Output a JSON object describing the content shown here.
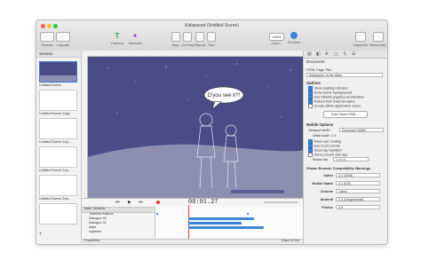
{
  "window": {
    "title": "Kidspaced (Untitled Scene)",
    "toolbar": {
      "left": [
        "Scenes",
        "Layouts"
      ],
      "center": [
        "Camera",
        "Symbols"
      ],
      "stage_tools": [
        "Stop",
        "Overlay",
        "Objects",
        "Text"
      ],
      "zoom_value": "100%",
      "right": [
        "Zoom",
        "Preview"
      ],
      "far_right": [
        "Inspector",
        "Resources"
      ]
    }
  },
  "sidebar": {
    "header": "Scenes",
    "scenes": [
      "Untitled Scene",
      "Untitled Scene Copy",
      "Untitled Scene Cop...",
      "Untitled Scene Cop...",
      "Untitled Scene Cop..."
    ]
  },
  "stage": {
    "speech_bubble": "D'you see it?!"
  },
  "timeline": {
    "time": "00:01.27",
    "header": "Main Timeline",
    "rows": [
      "Timeline Actions",
      "dialogue-02",
      "dialogue-01",
      "stars",
      "nightime"
    ],
    "footer_left": "Properties",
    "footer_right": "Ease in Out"
  },
  "inspector": {
    "tab_title": "Document",
    "html_page_title_label": "HTML Page Title",
    "html_page_title_value": "Kidspaced: In the Stars",
    "options_label": "Options",
    "options": [
      {
        "label": "Show loading indicator",
        "checked": true
      },
      {
        "label": "Draw scene backgrounds",
        "checked": true
      },
      {
        "label": "Use WebKit graphics acceleration",
        "checked": true
      },
      {
        "label": "Protect from external styles",
        "checked": true
      },
      {
        "label": "Create offline application cache",
        "checked": false
      }
    ],
    "edit_head_button": "Edit Head HTML...",
    "mobile_options_label": "Mobile Options",
    "viewport_label": "Viewport width",
    "viewport_value": "Document Width",
    "initial_scale": "Initial scale: 1.0",
    "mobile_options": [
      {
        "label": "Allow user scaling",
        "checked": true
      },
      {
        "label": "Use touch events",
        "checked": true
      },
      {
        "label": "Show tap highlight",
        "checked": true
      },
      {
        "label": "Home screen web app",
        "checked": false
      }
    ],
    "status_bar_label": "Status bar",
    "status_bar_value": "Default",
    "compat_label": "Shown Browser Compatibility Warnings",
    "browsers": [
      {
        "name": "Safari",
        "version": "3.1 (2008)"
      },
      {
        "name": "Mobile Safari",
        "version": "4.1 (iOS)"
      },
      {
        "name": "Chrome",
        "version": "Latest"
      },
      {
        "name": "Android",
        "version": "2.3 (Gingerbread)"
      },
      {
        "name": "Firefox",
        "version": "3.6"
      }
    ]
  },
  "colors": {
    "accent": "#3b88d8",
    "stage_sky": "#4a4c88",
    "playhead": "#e23b3b"
  }
}
